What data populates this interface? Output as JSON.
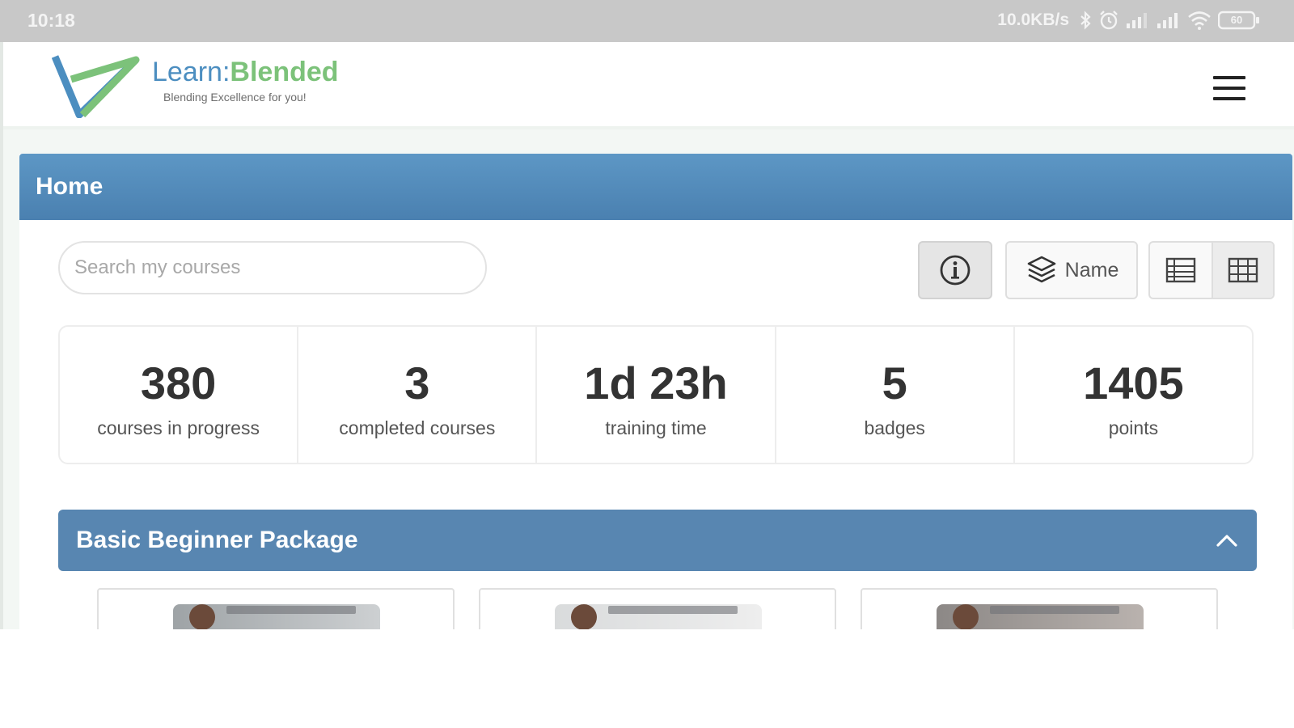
{
  "statusbar": {
    "time": "10:18",
    "network_speed": "10.0KB/s",
    "icons": [
      "bluetooth-icon",
      "alarm-icon",
      "signal-icon",
      "signal-icon",
      "wifi-icon",
      "battery-icon"
    ],
    "battery_label": "60"
  },
  "header": {
    "logo_learn": "Learn:",
    "logo_blended": "Blended",
    "tagline": "Blending Excellence for you!",
    "menu_icon": "hamburger-icon"
  },
  "page": {
    "title": "Home"
  },
  "search": {
    "placeholder": "Search my courses",
    "value": ""
  },
  "toolbar": {
    "info_icon": "info-icon",
    "sort_icon": "layers-icon",
    "sort_label": "Name",
    "list_view_icon": "list-view-icon",
    "grid_view_icon": "grid-view-icon"
  },
  "stats": [
    {
      "value": "380",
      "label": "courses in progress"
    },
    {
      "value": "3",
      "label": "completed courses"
    },
    {
      "value": "1d 23h",
      "label": "training time"
    },
    {
      "value": "5",
      "label": "badges"
    },
    {
      "value": "1405",
      "label": "points"
    }
  ],
  "package": {
    "title": "Basic Beginner Package",
    "toggle_icon": "chevron-up-icon"
  },
  "colors": {
    "header_blue": "#4f86b5",
    "package_blue": "#5886b1",
    "logo_blue": "#4c8ec0",
    "logo_green": "#7cc27a"
  }
}
